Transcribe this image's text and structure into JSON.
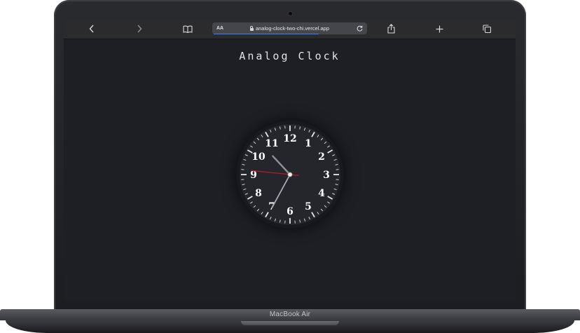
{
  "browser": {
    "toolbar": {
      "back_icon": "chevron-left-icon",
      "forward_icon": "chevron-right-icon",
      "bookmarks_icon": "book-icon",
      "text_size_label": "AA",
      "url": "analog-clock-two-chi.vercel.app",
      "lock_icon": "lock-icon",
      "reload_icon": "reload-icon",
      "share_icon": "share-icon",
      "new_tab_icon": "plus-icon",
      "tabs_icon": "tabs-icon"
    }
  },
  "page": {
    "title": "Analog Clock",
    "background_color": "#1d1f25"
  },
  "clock": {
    "numbers": [
      "12",
      "1",
      "2",
      "3",
      "4",
      "5",
      "6",
      "7",
      "8",
      "9",
      "10",
      "11"
    ],
    "face_color": "#24262c",
    "number_color": "#ffffff",
    "second_hand_color": "#c0152a",
    "time": {
      "hour": 10,
      "minute": 34,
      "second": 46
    }
  },
  "device": {
    "label": "MacBook Air"
  }
}
